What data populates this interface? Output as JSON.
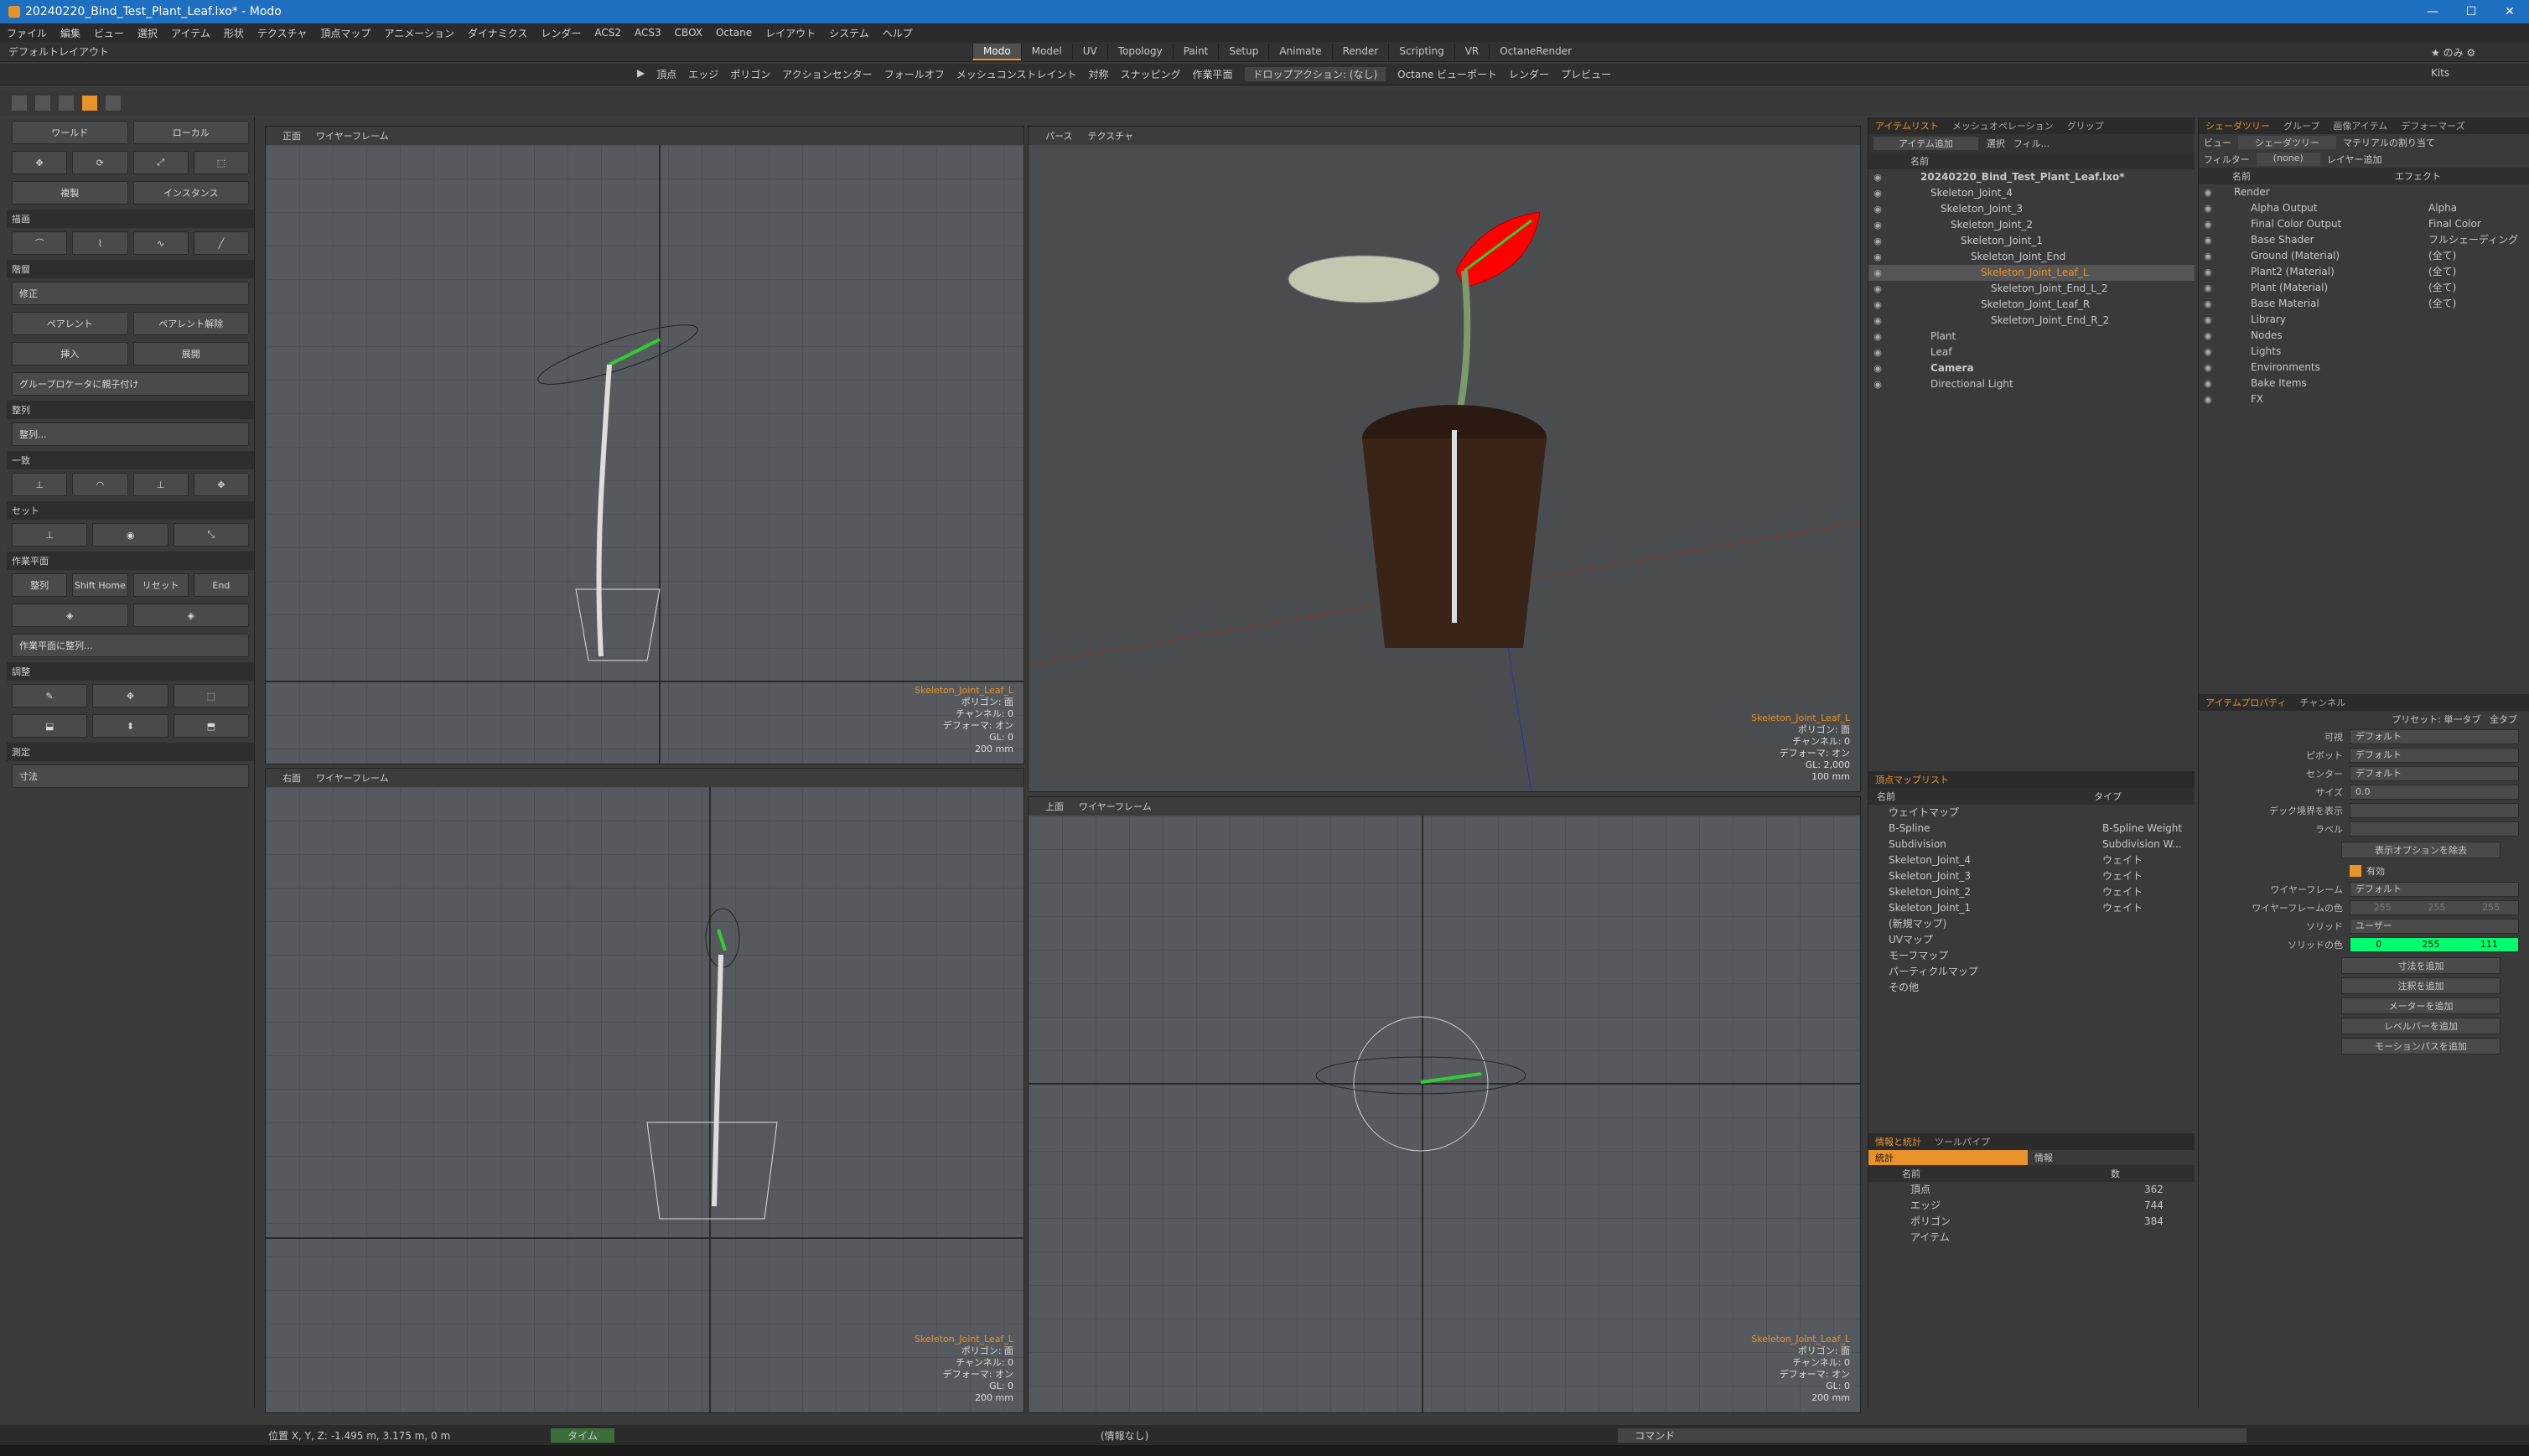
{
  "window": {
    "title": "20240220_Bind_Test_Plant_Leaf.lxo* - Modo"
  },
  "menu": [
    "ファイル",
    "編集",
    "ビュー",
    "選択",
    "アイテム",
    "形状",
    "テクスチャ",
    "頂点マップ",
    "アニメーション",
    "ダイナミクス",
    "レンダー",
    "ACS2",
    "ACS3",
    "CBOX",
    "Octane",
    "レイアウト",
    "システム",
    "ヘルプ"
  ],
  "layout": {
    "name": "デフォルトレイアウト"
  },
  "modes": [
    "Modo",
    "Model",
    "UV",
    "Topology",
    "Paint",
    "Setup",
    "Animate",
    "Render",
    "Scripting",
    "VR",
    "OctaneRender"
  ],
  "active_mode": "Modo",
  "toolbar": {
    "vertex": "頂点",
    "edge": "エッジ",
    "polygon": "ポリゴン",
    "action_center": "アクションセンター",
    "falloff": "フォールオフ",
    "mesh_constraint": "メッシュコンストレイント",
    "symmetry": "対称",
    "snapping": "スナッピング",
    "workplane": "作業平面",
    "drop_action": "ドロップアクション: (なし)",
    "octane_viewport": "Octane ビューポート",
    "render": "レンダー",
    "preview": "プレビュー",
    "right_label": "Kits"
  },
  "left_panel": {
    "world": "ワールド",
    "local": "ローカル",
    "duplicate": "複製",
    "instance": "インスタンス",
    "sections": [
      "描画",
      "階層",
      "整列",
      "一致",
      "セット",
      "作業平面",
      "調整",
      "測定"
    ],
    "correct": "修正",
    "parent": "ペアレント",
    "unparent": "ペアレント解除",
    "insert": "挿入",
    "expand": "展開",
    "group_parent": "グループロケータに親子付け",
    "align": "整列...",
    "wp_align": "整列",
    "wp_home": "Shift Home",
    "wp_reset": "リセット",
    "wp_end": "End",
    "align_to_wp": "作業平面に整列...",
    "measure": "寸法"
  },
  "viewports": [
    {
      "view": "正面",
      "mode": "ワイヤーフレーム",
      "info": [
        "Skeleton_Joint_Leaf_L",
        "ポリゴン: 面",
        "チャンネル: 0",
        "デフォーマ: オン",
        "GL: 0",
        "200 mm"
      ]
    },
    {
      "view": "パース",
      "mode": "テクスチャ",
      "info": [
        "Skeleton_Joint_Leaf_L",
        "ポリゴン: 面",
        "チャンネル: 0",
        "デフォーマ: オン",
        "GL: 2,000",
        "100 mm"
      ]
    },
    {
      "view": "右面",
      "mode": "ワイヤーフレーム",
      "info": [
        "Skeleton_Joint_Leaf_L",
        "ポリゴン: 面",
        "チャンネル: 0",
        "デフォーマ: オン",
        "GL: 0",
        "200 mm"
      ]
    },
    {
      "view": "上面",
      "mode": "ワイヤーフレーム",
      "info": [
        "Skeleton_Joint_Leaf_L",
        "ポリゴン: 面",
        "チャンネル: 0",
        "デフォーマ: オン",
        "GL: 0",
        "200 mm"
      ]
    }
  ],
  "item_list": {
    "tabs": [
      "アイテムリスト",
      "メッシュオペレーション",
      "グリップ"
    ],
    "add_item": "アイテム追加",
    "select": "選択",
    "filter": "フィル...",
    "col_name": "名前",
    "items": [
      {
        "label": "20240220_Bind_Test_Plant_Leaf.lxo*",
        "depth": 0,
        "bold": true
      },
      {
        "label": "Skeleton_Joint_4",
        "depth": 1
      },
      {
        "label": "Skeleton_Joint_3",
        "depth": 2
      },
      {
        "label": "Skeleton_Joint_2",
        "depth": 3
      },
      {
        "label": "Skeleton_Joint_1",
        "depth": 4
      },
      {
        "label": "Skeleton_Joint_End",
        "depth": 5
      },
      {
        "label": "Skeleton_Joint_Leaf_L",
        "depth": 6,
        "selected": true
      },
      {
        "label": "Skeleton_Joint_End_L_2",
        "depth": 7
      },
      {
        "label": "Skeleton_Joint_Leaf_R",
        "depth": 6
      },
      {
        "label": "Skeleton_Joint_End_R_2",
        "depth": 7
      },
      {
        "label": "Plant",
        "depth": 1
      },
      {
        "label": "Leaf",
        "depth": 1
      },
      {
        "label": "Camera",
        "depth": 1,
        "bold": true
      },
      {
        "label": "Directional Light",
        "depth": 1
      }
    ]
  },
  "vertex_map": {
    "title": "頂点マップリスト",
    "col_name": "名前",
    "col_type": "タイプ",
    "rows": [
      {
        "name": "ウェイトマップ",
        "type": ""
      },
      {
        "name": "B-Spline",
        "type": "B-Spline Weight"
      },
      {
        "name": "Subdivision",
        "type": "Subdivision W..."
      },
      {
        "name": "Skeleton_Joint_4",
        "type": "ウェイト"
      },
      {
        "name": "Skeleton_Joint_3",
        "type": "ウェイト"
      },
      {
        "name": "Skeleton_Joint_2",
        "type": "ウェイト"
      },
      {
        "name": "Skeleton_Joint_1",
        "type": "ウェイト"
      },
      {
        "name": "(新規マップ)",
        "type": ""
      },
      {
        "name": "UVマップ",
        "type": ""
      },
      {
        "name": "モーフマップ",
        "type": ""
      },
      {
        "name": "パーティクルマップ",
        "type": ""
      },
      {
        "name": "その他",
        "type": ""
      }
    ]
  },
  "stats": {
    "tabs": [
      "情報と統計",
      "ツールパイプ"
    ],
    "subtabs": [
      "統計",
      "情報"
    ],
    "col_name": "名前",
    "col_count": "数",
    "rows": [
      {
        "name": "頂点",
        "count": "362"
      },
      {
        "name": "エッジ",
        "count": "744"
      },
      {
        "name": "ポリゴン",
        "count": "384"
      },
      {
        "name": "アイテム",
        "count": ""
      }
    ]
  },
  "shader_tree": {
    "tabs": [
      "シェーダツリー",
      "グループ",
      "画像アイテム",
      "デフォーマーズ"
    ],
    "view": "ビュー",
    "view_value": "シェーダツリー",
    "assign": "マテリアルの割り当て",
    "filter": "フィルター",
    "filter_value": "(none)",
    "add_layer": "レイヤー追加",
    "col_name": "名前",
    "col_effect": "エフェクト",
    "rows": [
      {
        "name": "Render",
        "effect": ""
      },
      {
        "name": "Alpha Output",
        "effect": "Alpha"
      },
      {
        "name": "Final Color Output",
        "effect": "Final Color"
      },
      {
        "name": "Base Shader",
        "effect": "フルシェーディング"
      },
      {
        "name": "Ground (Material)",
        "effect": "(全て)"
      },
      {
        "name": "Plant2 (Material)",
        "effect": "(全て)"
      },
      {
        "name": "Plant (Material)",
        "effect": "(全て)"
      },
      {
        "name": "Base Material",
        "effect": "(全て)"
      },
      {
        "name": "Library",
        "effect": ""
      },
      {
        "name": "Nodes",
        "effect": ""
      },
      {
        "name": "Lights",
        "effect": ""
      },
      {
        "name": "Environments",
        "effect": ""
      },
      {
        "name": "Bake Items",
        "effect": ""
      },
      {
        "name": "FX",
        "effect": ""
      }
    ]
  },
  "properties": {
    "tabs": [
      "アイテムプロパティ",
      "チャンネル"
    ],
    "preset": "プリセット: 単一タブ",
    "all_tabs": "全タブ",
    "rows": [
      {
        "label": "可視",
        "value": "デフォルト"
      },
      {
        "label": "ピボット",
        "value": "デフォルト"
      },
      {
        "label": "センター",
        "value": "デフォルト"
      },
      {
        "label": "サイズ",
        "value": "0.0"
      },
      {
        "label": "デック境界を表示",
        "value": ""
      },
      {
        "label": "ラベル",
        "value": ""
      }
    ],
    "display_option": "表示オプションを除去",
    "enabled": "有効",
    "wireframe_label": "ワイヤーフレーム",
    "wireframe_value": "デフォルト",
    "wire_color_label": "ワイヤーフレームの色",
    "wire_color": [
      "255",
      "255",
      "255"
    ],
    "solid_label": "ソリッド",
    "solid_value": "ユーザー",
    "solid_color_label": "ソリッドの色",
    "solid_color": [
      "0",
      "255",
      "111"
    ],
    "add_buttons": [
      "寸法を追加",
      "注釈を追加",
      "メーターを追加",
      "レベルバーを追加",
      "モーションパスを追加"
    ]
  },
  "status": {
    "position": "位置 X, Y, Z:  -1.495 m, 3.175 m, 0 m",
    "time": "タイム",
    "center": "(情報なし)",
    "command": "コマンド"
  },
  "colors": {
    "accent": "#e8922a",
    "selection_red": "#ff0000",
    "bone_green": "#33cc33",
    "titlebar": "#1f6fc0"
  }
}
